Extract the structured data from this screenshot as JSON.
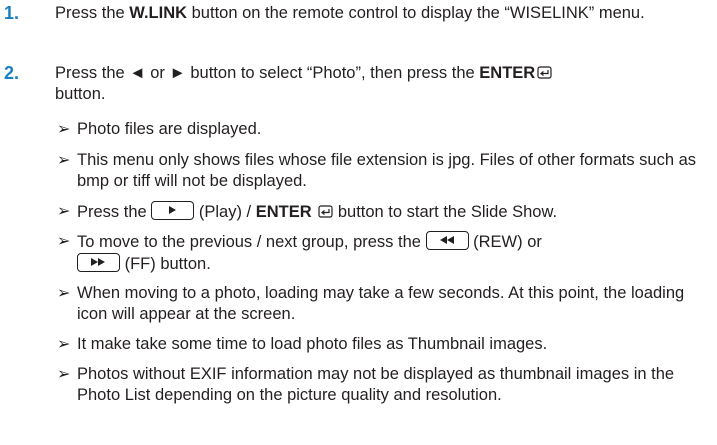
{
  "steps": [
    {
      "number": "1.",
      "pre": "Press the ",
      "bold": "W.LINK",
      "post": " button on the remote control to display the “WISELINK” menu."
    },
    {
      "number": "2.",
      "pre": "Press the ◄ or ► button to select “Photo”, then press the ",
      "bold": "ENTER",
      "post": "button."
    }
  ],
  "notes": {
    "arrow": "➢",
    "n1": "Photo files are displayed.",
    "n2": "This menu only shows files whose file extension is jpg. Files of other formats such as bmp or tiff will not be displayed.",
    "n3_pre": "Press the",
    "n3_mid": "(Play) / ",
    "n3_bold": "ENTER",
    "n3_post": "button to start the Slide Show.",
    "n4_pre": "To move to the previous / next group, press the",
    "n4_mid": "(REW) or",
    "n4_post": "(FF) button.",
    "n5": "When moving to a photo, loading may take a few seconds. At this point, the loading icon will appear at the screen.",
    "n6": "It make take some time to load photo files as Thumbnail images.",
    "n7": "Photos without EXIF information may not be displayed as thumbnail images in the Photo List depending on the picture quality and resolution."
  },
  "icons": {
    "enter": "enter-icon",
    "play": "play-button-icon",
    "rew": "rewind-button-icon",
    "ff": "fast-forward-button-icon"
  },
  "colors": {
    "step_number": "#1a7fc1",
    "text": "#231f20"
  }
}
